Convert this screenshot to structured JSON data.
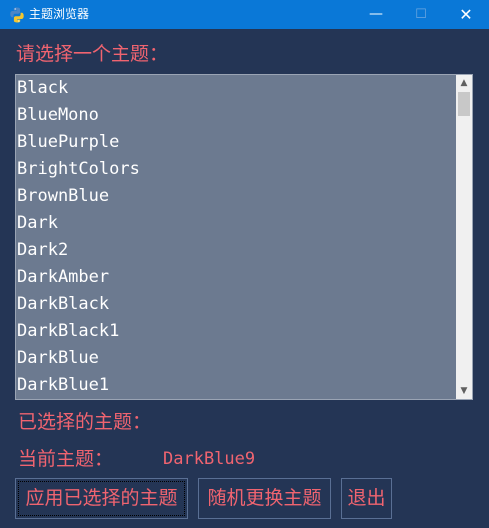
{
  "window": {
    "title": "主题浏览器",
    "app_icon": "python-icon",
    "controls": {
      "minimize": "—",
      "maximize": "☐",
      "close": "✕"
    }
  },
  "prompt_label": "请选择一个主题：",
  "themes": [
    "Black",
    "BlueMono",
    "BluePurple",
    "BrightColors",
    "BrownBlue",
    "Dark",
    "Dark2",
    "DarkAmber",
    "DarkBlack",
    "DarkBlack1",
    "DarkBlue",
    "DarkBlue1"
  ],
  "scrollbar": {
    "up": "▲",
    "down": "▼"
  },
  "selected_label": "已选择的主题：",
  "current_label": "当前主题：",
  "current_value": "DarkBlue9",
  "buttons": {
    "apply": "应用已选择的主题",
    "random": "随机更换主题",
    "exit": "退出"
  },
  "colors": {
    "background": "#243555",
    "accent_text": "#f06470",
    "listbox_bg": "#6c7a90",
    "titlebar": "#0a78d7"
  }
}
